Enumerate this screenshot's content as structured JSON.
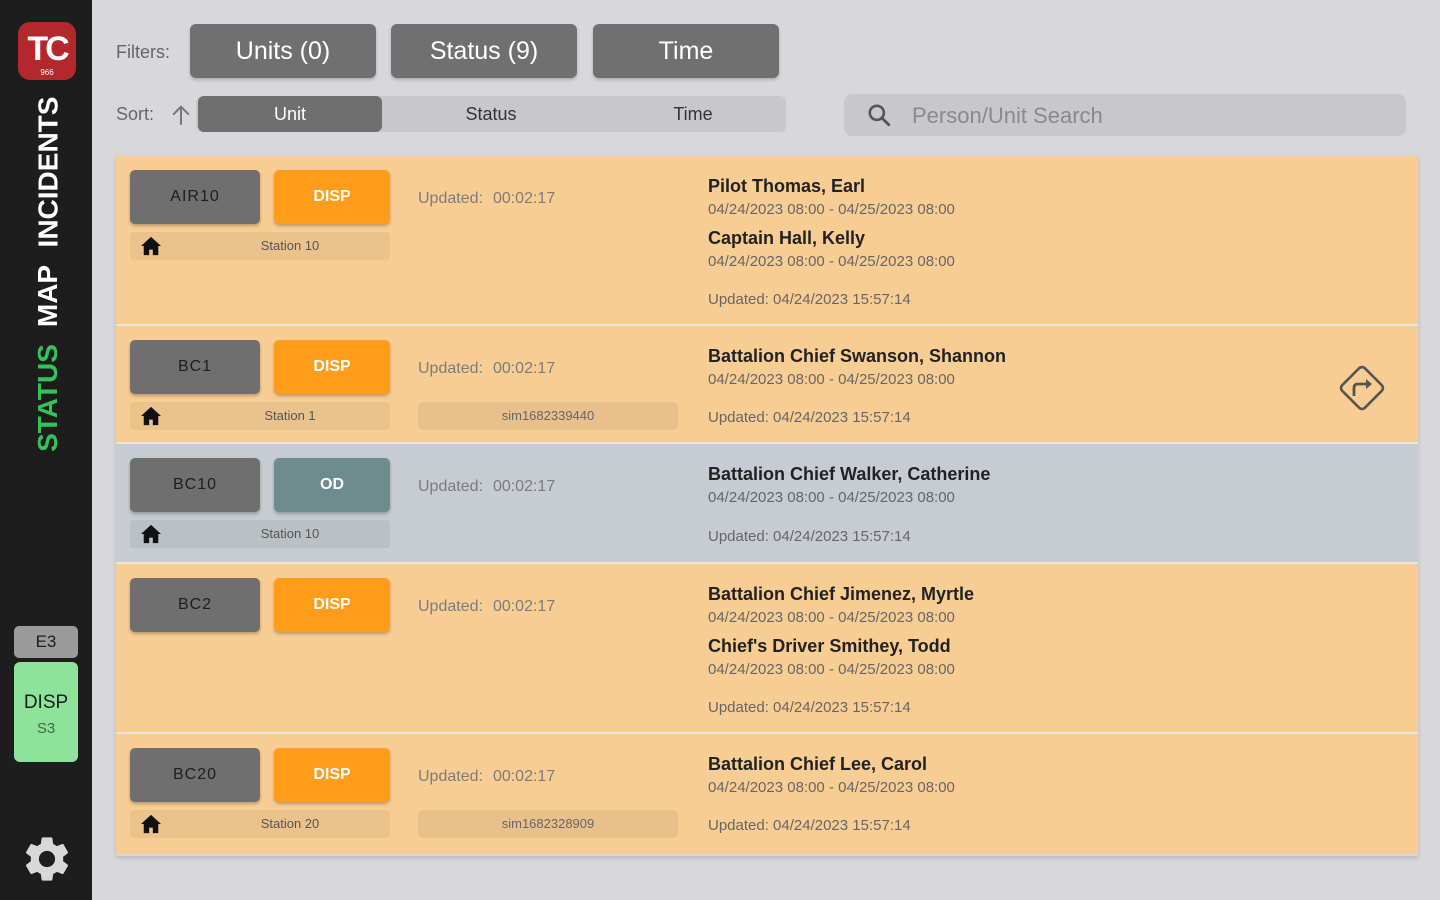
{
  "sidebar": {
    "logo_text": "TC",
    "logo_sub": "966",
    "nav": [
      "INCIDENTS",
      "MAP",
      "STATUS"
    ],
    "active_nav": "STATUS",
    "current_unit": "E3",
    "current_status": "DISP",
    "current_station": "S3",
    "settings_icon": "gear-icon"
  },
  "filters": {
    "label": "Filters:",
    "units": "Units (0)",
    "status": "Status (9)",
    "time": "Time"
  },
  "sort": {
    "label": "Sort:",
    "direction_icon": "arrow-up-icon",
    "options": [
      "Unit",
      "Status",
      "Time"
    ],
    "selected": "Unit"
  },
  "search": {
    "placeholder": "Person/Unit Search",
    "value": ""
  },
  "colors": {
    "disp": "#ff9c19",
    "od": "#6e8b8d",
    "row_orange": "#f8cd94",
    "row_grey": "#c6ccd1",
    "status_active": "#35c25b"
  },
  "rows": [
    {
      "unit": "AIR10",
      "status": "DISP",
      "station": "Station 10",
      "updated_label": "Updated:",
      "updated": "00:02:17",
      "sim": "",
      "people": [
        {
          "name": "Pilot Thomas, Earl",
          "time": "04/24/2023 08:00 - 04/25/2023 08:00"
        },
        {
          "name": "Captain Hall, Kelly",
          "time": "04/24/2023 08:00 - 04/25/2023 08:00"
        }
      ],
      "row_updated": "Updated: 04/24/2023 15:57:14"
    },
    {
      "unit": "BC1",
      "status": "DISP",
      "station": "Station 1",
      "updated_label": "Updated:",
      "updated": "00:02:17",
      "sim": "sim1682339440",
      "people": [
        {
          "name": "Battalion Chief Swanson, Shannon",
          "time": "04/24/2023 08:00 - 04/25/2023 08:00"
        }
      ],
      "row_updated": "Updated: 04/24/2023 15:57:14",
      "nav_icon": "directions-icon"
    },
    {
      "unit": "BC10",
      "status": "OD",
      "station": "Station 10",
      "updated_label": "Updated:",
      "updated": "00:02:17",
      "sim": "",
      "people": [
        {
          "name": "Battalion Chief Walker, Catherine",
          "time": "04/24/2023 08:00 - 04/25/2023 08:00"
        }
      ],
      "row_updated": "Updated: 04/24/2023 15:57:14"
    },
    {
      "unit": "BC2",
      "status": "DISP",
      "station": "",
      "updated_label": "Updated:",
      "updated": "00:02:17",
      "sim": "",
      "people": [
        {
          "name": "Battalion Chief Jimenez, Myrtle",
          "time": "04/24/2023 08:00 - 04/25/2023 08:00"
        },
        {
          "name": "Chief's Driver Smithey, Todd",
          "time": "04/24/2023 08:00 - 04/25/2023 08:00"
        }
      ],
      "row_updated": "Updated: 04/24/2023 15:57:14"
    },
    {
      "unit": "BC20",
      "status": "DISP",
      "station": "Station 20",
      "updated_label": "Updated:",
      "updated": "00:02:17",
      "sim": "sim1682328909",
      "people": [
        {
          "name": "Battalion Chief Lee, Carol",
          "time": "04/24/2023 08:00 - 04/25/2023 08:00"
        }
      ],
      "row_updated": "Updated: 04/24/2023 15:57:14"
    }
  ]
}
